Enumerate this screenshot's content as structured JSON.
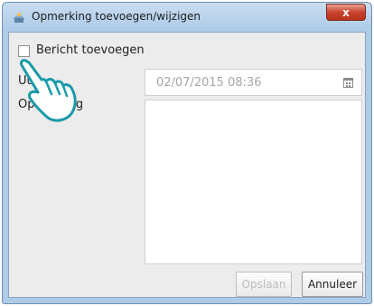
{
  "window": {
    "title": "Opmerking toevoegen/wijzigen",
    "close_label": "x"
  },
  "form": {
    "checkbox_label": "Bericht toevoegen",
    "checkbox_checked": false,
    "time_label": "Uur",
    "time_value": "02/07/2015 08:36",
    "remark_label": "Opmerking",
    "remark_value": ""
  },
  "buttons": {
    "save_label": "Opslaan",
    "cancel_label": "Annuleer"
  },
  "icons": {
    "app": "app-icon",
    "calendar": "calendar-icon",
    "pointer": "hand-pointer-icon"
  },
  "colors": {
    "hand": "#1a9aa8",
    "close": "#c9432d",
    "disabled_text": "#bdbdbd"
  }
}
